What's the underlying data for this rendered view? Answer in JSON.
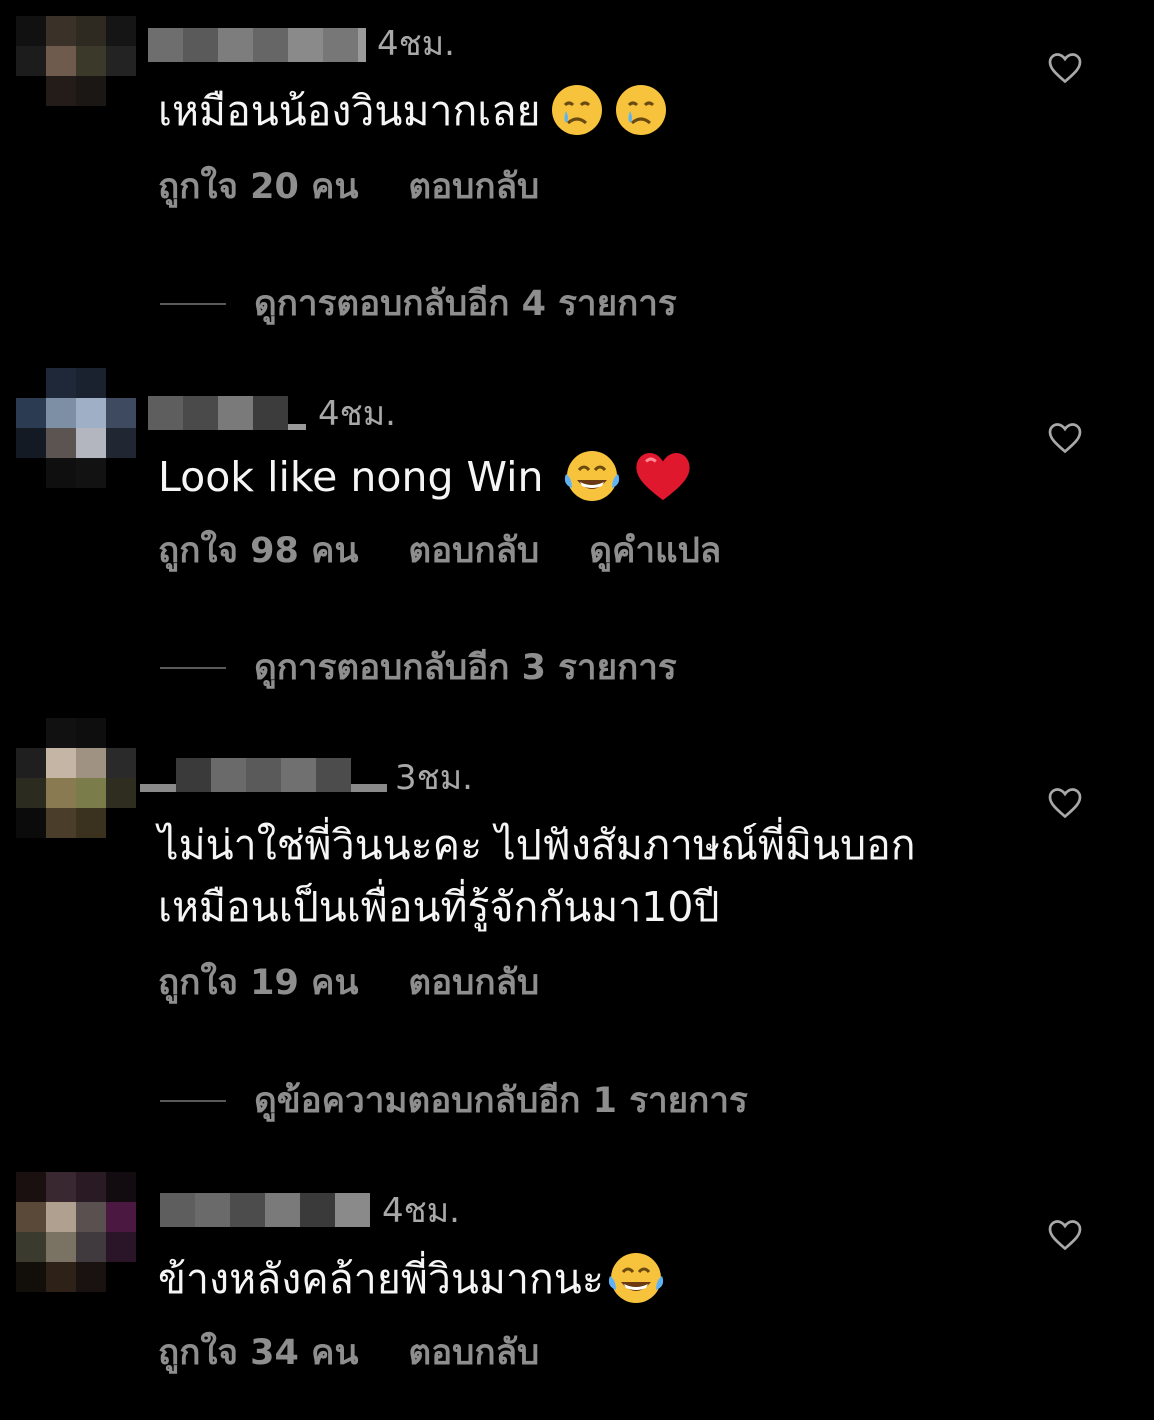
{
  "comments": [
    {
      "time": "4ชม.",
      "text": "เหมือนน้องวินมากเลย",
      "emojis": [
        "crying-face",
        "crying-face"
      ],
      "likes": "ถูกใจ 20 คน",
      "reply": "ตอบกลับ",
      "translate": "",
      "view_replies": "ดูการตอบกลับอีก 4 รายการ"
    },
    {
      "time": "4ชม.",
      "text": "Look like nong Win",
      "emojis": [
        "tears-of-joy",
        "red-heart"
      ],
      "likes": "ถูกใจ 98 คน",
      "reply": "ตอบกลับ",
      "translate": "ดูคำแปล",
      "view_replies": "ดูการตอบกลับอีก 3 รายการ"
    },
    {
      "time": "3ชม.",
      "text_line1": "ไม่น่าใช่พี่วินนะคะ ไปฟังสัมภาษณ์พี่มินบอก",
      "text_line2": "เหมือนเป็นเพื่อนที่รู้จักกันมา10ปี",
      "likes": "ถูกใจ 19 คน",
      "reply": "ตอบกลับ",
      "view_replies": "ดูข้อความตอบกลับอีก 1 รายการ"
    },
    {
      "time": "4ชม.",
      "text": "ข้างหลังคล้ายพี่วินมากนะ",
      "emojis": [
        "tears-of-joy"
      ],
      "likes": "ถูกใจ 34 คน",
      "reply": "ตอบกลับ"
    }
  ],
  "colors": {
    "background": "#000000",
    "secondary_text": "#8e8e8e",
    "heart_red": "#e0182d",
    "emoji_yellow": "#f8c33c"
  }
}
